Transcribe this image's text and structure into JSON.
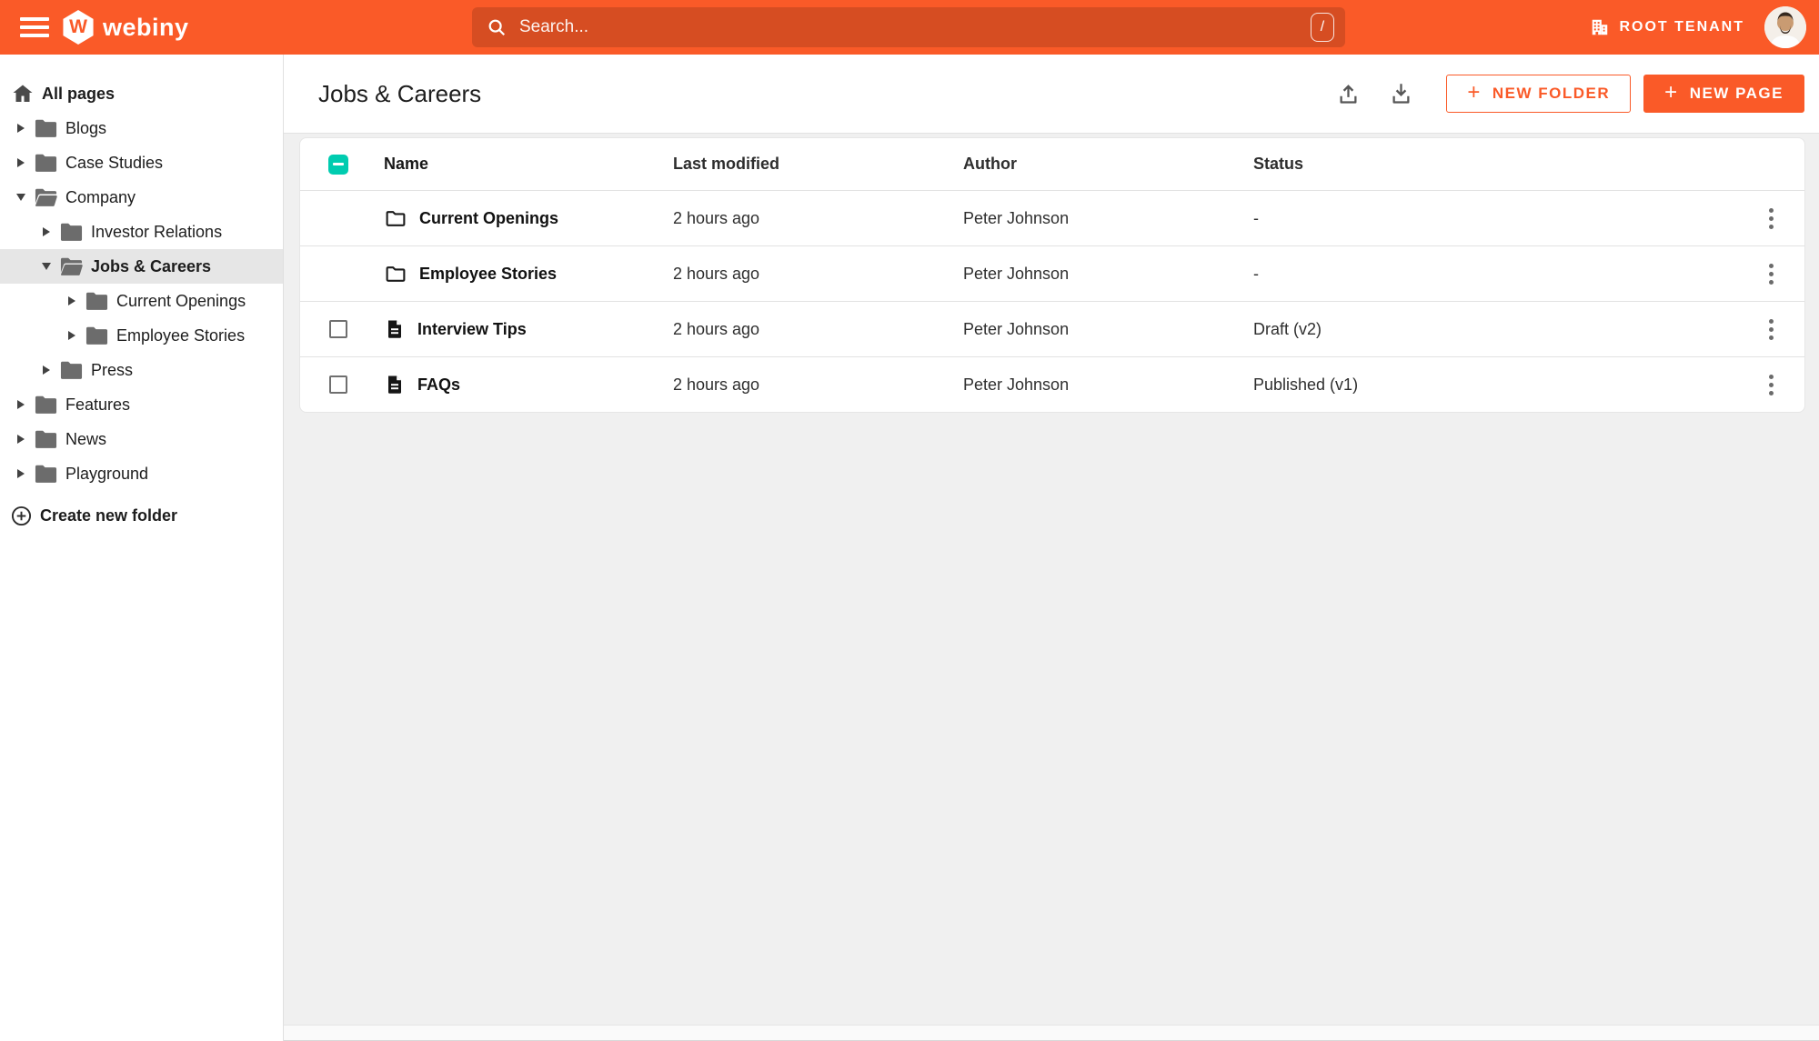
{
  "topbar": {
    "brand": "webiny",
    "brand_letter": "W",
    "search_placeholder": "Search...",
    "search_shortcut": "/",
    "tenant_label": "ROOT TENANT"
  },
  "colors": {
    "accent_orange": "#fa5a28",
    "checkbox_teal": "#00ccb0",
    "sidebar_selected": "#e6e6e6",
    "body_background": "#f0f0f0"
  },
  "sidebar": {
    "root_label": "All pages",
    "create_folder_label": "Create new folder",
    "items": [
      {
        "label": "Blogs",
        "depth": 1,
        "state": "collapsed",
        "selected": false
      },
      {
        "label": "Case Studies",
        "depth": 1,
        "state": "collapsed",
        "selected": false
      },
      {
        "label": "Company",
        "depth": 1,
        "state": "expanded",
        "selected": false
      },
      {
        "label": "Investor Relations",
        "depth": 2,
        "state": "collapsed",
        "selected": false
      },
      {
        "label": "Jobs & Careers",
        "depth": 2,
        "state": "expanded",
        "selected": true
      },
      {
        "label": "Current Openings",
        "depth": 3,
        "state": "collapsed",
        "selected": false
      },
      {
        "label": "Employee Stories",
        "depth": 3,
        "state": "collapsed",
        "selected": false
      },
      {
        "label": "Press",
        "depth": 2,
        "state": "collapsed",
        "selected": false
      },
      {
        "label": "Features",
        "depth": 1,
        "state": "collapsed",
        "selected": false
      },
      {
        "label": "News",
        "depth": 1,
        "state": "collapsed",
        "selected": false
      },
      {
        "label": "Playground",
        "depth": 1,
        "state": "collapsed",
        "selected": false
      }
    ]
  },
  "header": {
    "title": "Jobs & Careers",
    "new_folder_label": "NEW FOLDER",
    "new_page_label": "NEW PAGE",
    "plus_glyph": "+"
  },
  "table": {
    "columns": [
      "Name",
      "Last modified",
      "Author",
      "Status"
    ],
    "select_all_state": "indeterminate",
    "rows": [
      {
        "type": "folder",
        "name": "Current Openings",
        "modified": "2 hours ago",
        "author": "Peter Johnson",
        "status": "-",
        "has_checkbox": false,
        "checked": false
      },
      {
        "type": "folder",
        "name": "Employee Stories",
        "modified": "2 hours ago",
        "author": "Peter Johnson",
        "status": "-",
        "has_checkbox": false,
        "checked": false
      },
      {
        "type": "page",
        "name": "Interview Tips",
        "modified": "2 hours ago",
        "author": "Peter Johnson",
        "status": "Draft (v2)",
        "has_checkbox": true,
        "checked": false
      },
      {
        "type": "page",
        "name": "FAQs",
        "modified": "2 hours ago",
        "author": "Peter Johnson",
        "status": "Published (v1)",
        "has_checkbox": true,
        "checked": false
      }
    ]
  }
}
